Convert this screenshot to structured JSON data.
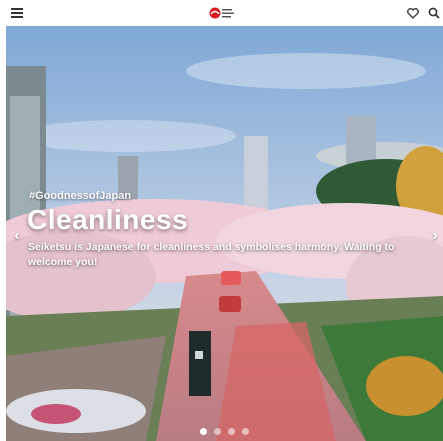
{
  "header": {
    "icons": [
      "hamburger-menu-icon",
      "brand-logo",
      "heart-icon",
      "search-icon"
    ],
    "colors": {
      "logo_red": "#d71920",
      "icon": "#333333"
    }
  },
  "hero": {
    "hashtag": "#GoodnessofJapan",
    "title": "Cleanliness",
    "subtitle": "Seiketsu is Japanese for cleanliness and symbolises harmony. Waiting to welcome you!",
    "prev_icon": "‹",
    "next_icon": "›",
    "slides_total": 4,
    "active_slide": 1
  }
}
